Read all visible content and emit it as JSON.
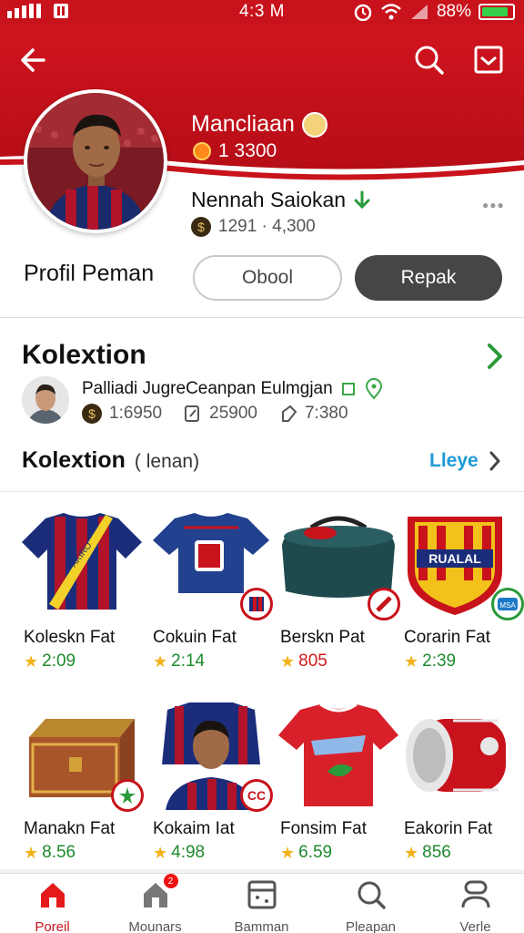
{
  "status_bar": {
    "time": "4:3 M",
    "battery": "88%",
    "battery_level": 0.88
  },
  "header": {
    "club_name": "Mancliaan",
    "club_coins": "1 3300",
    "player_name": "Nennah Saiokan",
    "player_stats": "1291 · 4,300",
    "profile_title": "Profil Peman",
    "follow_label": "Obool",
    "report_label": "Repak",
    "colors": {
      "brand_red": "#c8121c",
      "dark_button": "#464646"
    }
  },
  "collection": {
    "title": "Kolextion",
    "owner_name": "Palliadi JugreCeanpan Eulmgjan",
    "owner_stats": [
      {
        "icon": "coin-icon",
        "value": "1:6950"
      },
      {
        "icon": "edit-icon",
        "value": "25900"
      },
      {
        "icon": "tag-icon",
        "value": "7:380"
      }
    ],
    "sub_title": "Kolextion",
    "sub_title_paren": "( lenan)",
    "view_label": "Lleye",
    "items": [
      {
        "name": "Koleskn Fat",
        "price": "2:09",
        "price_color": "green",
        "icon": "striped-jersey-icon"
      },
      {
        "name": "Cokuin Fat",
        "price": "2:14",
        "price_color": "green",
        "icon": "blue-jersey-icon"
      },
      {
        "name": "Berskn Pat",
        "price": "805",
        "price_color": "red",
        "icon": "kit-bag-icon"
      },
      {
        "name": "Corarin Fat",
        "price": "2:39",
        "price_color": "green",
        "icon": "club-crest-icon"
      },
      {
        "name": "Manakn Fat",
        "price": "8.56",
        "price_color": "green",
        "icon": "treasure-chest-icon"
      },
      {
        "name": "Kokaim Iat",
        "price": "4:98",
        "price_color": "green",
        "icon": "player-card-icon"
      },
      {
        "name": "Fonsim Fat",
        "price": "6.59",
        "price_color": "green",
        "icon": "red-jersey-icon"
      },
      {
        "name": "Eakorin Fat",
        "price": "856",
        "price_color": "green",
        "icon": "red-barrel-icon"
      }
    ]
  },
  "tabbar": {
    "tabs": [
      {
        "label": "Poreil",
        "icon": "home-icon",
        "active": true
      },
      {
        "label": "Mounars",
        "icon": "store-icon",
        "badge": "2"
      },
      {
        "label": "Bamman",
        "icon": "card-icon"
      },
      {
        "label": "Pleapan",
        "icon": "search-icon"
      },
      {
        "label": "Verle",
        "icon": "profile-icon"
      }
    ]
  }
}
